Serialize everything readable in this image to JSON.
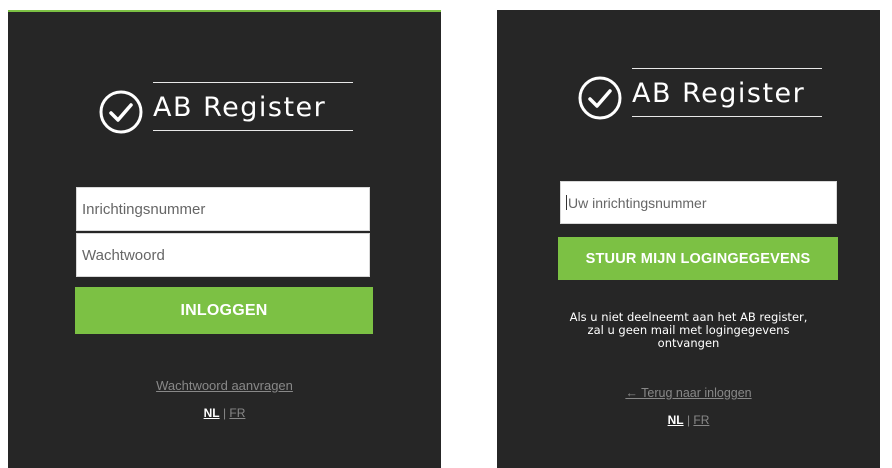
{
  "login": {
    "brand": "AB Register",
    "username_placeholder": "Inrichtingsnummer",
    "password_placeholder": "Wachtwoord",
    "submit_label": "INLOGGEN",
    "forgot_link": "Wachtwoord aanvragen",
    "lang_nl": "NL",
    "lang_sep": "|",
    "lang_fr": "FR"
  },
  "forgot": {
    "brand": "AB Register",
    "number_placeholder": "Uw inrichtingsnummer",
    "submit_label": "STUUR MIJN LOGINGEGEVENS",
    "notice_line1": "Als u niet deelneemt aan het AB register,",
    "notice_line2": "zal u geen mail met logingegevens",
    "notice_line3": "ontvangen",
    "back_link": "← Terug naar inloggen",
    "lang_nl": "NL",
    "lang_sep": "|",
    "lang_fr": "FR"
  },
  "colors": {
    "background": "#262626",
    "accent": "#7cc144",
    "text": "#ffffff",
    "muted": "#888888"
  },
  "icons": {
    "logo": "check-circle-icon"
  }
}
